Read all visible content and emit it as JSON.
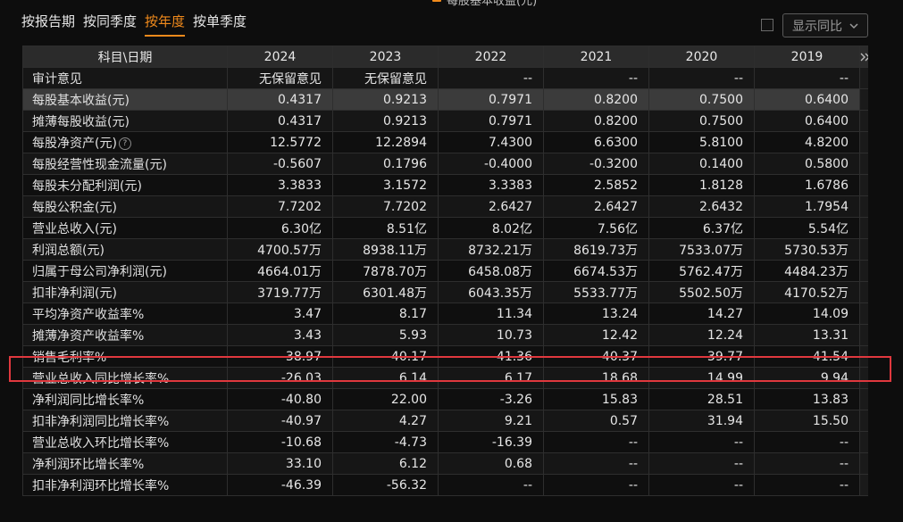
{
  "legend": {
    "label": "每股基本收益(元)",
    "color": "#f08a1c"
  },
  "tabs": [
    {
      "label": "按报告期"
    },
    {
      "label": "按同季度"
    },
    {
      "label": "按年度",
      "active": true
    },
    {
      "label": "按单季度"
    }
  ],
  "compare_select": {
    "label": "显示同比"
  },
  "table": {
    "header": [
      "科目\\日期",
      "2024",
      "2023",
      "2022",
      "2021",
      "2020",
      "2019"
    ],
    "rows": [
      {
        "label": "审计意见",
        "values": [
          "无保留意见",
          "无保留意见",
          "--",
          "--",
          "--",
          "--"
        ]
      },
      {
        "label": "每股基本收益(元)",
        "values": [
          "0.4317",
          "0.9213",
          "0.7971",
          "0.8200",
          "0.7500",
          "0.6400"
        ],
        "selected": true
      },
      {
        "label": "摊薄每股收益(元)",
        "values": [
          "0.4317",
          "0.9213",
          "0.7971",
          "0.8200",
          "0.7500",
          "0.6400"
        ]
      },
      {
        "label": "每股净资产(元)",
        "values": [
          "12.5772",
          "12.2894",
          "7.4300",
          "6.6300",
          "5.8100",
          "4.8200"
        ],
        "help": true
      },
      {
        "label": "每股经营性现金流量(元)",
        "values": [
          "-0.5607",
          "0.1796",
          "-0.4000",
          "-0.3200",
          "0.1400",
          "0.5800"
        ]
      },
      {
        "label": "每股未分配利润(元)",
        "values": [
          "3.3833",
          "3.1572",
          "3.3383",
          "2.5852",
          "1.8128",
          "1.6786"
        ]
      },
      {
        "label": "每股公积金(元)",
        "values": [
          "7.7202",
          "7.7202",
          "2.6427",
          "2.6427",
          "2.6432",
          "1.7954"
        ]
      },
      {
        "label": "营业总收入(元)",
        "values": [
          "6.30亿",
          "8.51亿",
          "8.02亿",
          "7.56亿",
          "6.37亿",
          "5.54亿"
        ]
      },
      {
        "label": "利润总额(元)",
        "values": [
          "4700.57万",
          "8938.11万",
          "8732.21万",
          "8619.73万",
          "7533.07万",
          "5730.53万"
        ]
      },
      {
        "label": "归属于母公司净利润(元)",
        "values": [
          "4664.01万",
          "7878.70万",
          "6458.08万",
          "6674.53万",
          "5762.47万",
          "4484.23万"
        ]
      },
      {
        "label": "扣非净利润(元)",
        "values": [
          "3719.77万",
          "6301.48万",
          "6043.35万",
          "5533.77万",
          "5502.50万",
          "4170.52万"
        ]
      },
      {
        "label": "平均净资产收益率%",
        "values": [
          "3.47",
          "8.17",
          "11.34",
          "13.24",
          "14.27",
          "14.09"
        ]
      },
      {
        "label": "摊薄净资产收益率%",
        "values": [
          "3.43",
          "5.93",
          "10.73",
          "12.42",
          "12.24",
          "13.31"
        ]
      },
      {
        "label": "销售毛利率%",
        "values": [
          "38.97",
          "40.17",
          "41.36",
          "40.37",
          "39.77",
          "41.54"
        ]
      },
      {
        "label": "营业总收入同比增长率%",
        "values": [
          "-26.03",
          "6.14",
          "6.17",
          "18.68",
          "14.99",
          "9.94"
        ]
      },
      {
        "label": "净利润同比增长率%",
        "values": [
          "-40.80",
          "22.00",
          "-3.26",
          "15.83",
          "28.51",
          "13.83"
        ]
      },
      {
        "label": "扣非净利润同比增长率%",
        "values": [
          "-40.97",
          "4.27",
          "9.21",
          "0.57",
          "31.94",
          "15.50"
        ]
      },
      {
        "label": "营业总收入环比增长率%",
        "values": [
          "-10.68",
          "-4.73",
          "-16.39",
          "--",
          "--",
          "--"
        ]
      },
      {
        "label": "净利润环比增长率%",
        "values": [
          "33.10",
          "6.12",
          "0.68",
          "--",
          "--",
          "--"
        ]
      },
      {
        "label": "扣非净利润环比增长率%",
        "values": [
          "-46.39",
          "-56.32",
          "--",
          "--",
          "--",
          "--"
        ]
      }
    ]
  }
}
